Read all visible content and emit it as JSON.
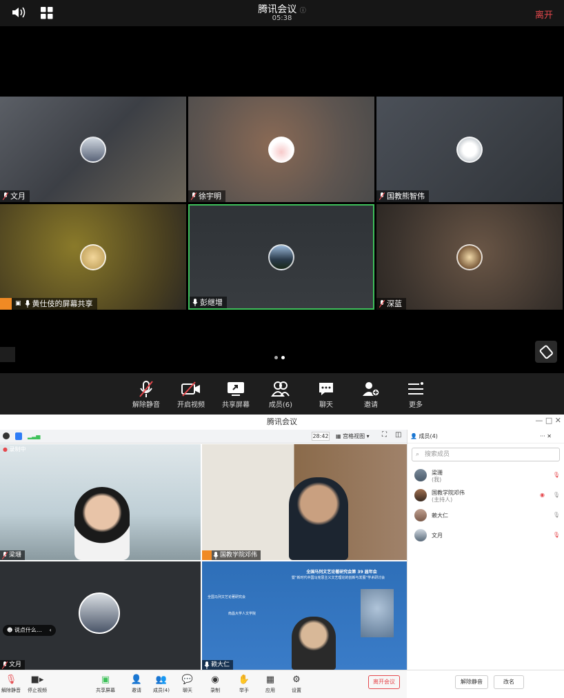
{
  "top": {
    "title": "腾讯会议",
    "timer": "05:38",
    "leave": "离开",
    "tiles": [
      {
        "name": "文月"
      },
      {
        "name": "徐宇明"
      },
      {
        "name": "国教熊智伟"
      },
      {
        "name": "黄仕伎的屏幕共享"
      },
      {
        "name": "彭继增"
      },
      {
        "name": "深蓝"
      }
    ],
    "toolbar": {
      "unmute": "解除静音",
      "start_video": "开启视频",
      "share_screen": "共享屏幕",
      "members": "成员(6)",
      "chat": "聊天",
      "invite": "邀请",
      "more": "更多"
    }
  },
  "bottom": {
    "title": "腾讯会议",
    "timer": "28:42",
    "grid_view": "宫格视图",
    "recording": "录制中",
    "tiles": [
      {
        "name": "梁珊"
      },
      {
        "name": "国教学院邓伟"
      },
      {
        "name": "文月"
      },
      {
        "name": "赖大仁"
      }
    ],
    "caption": "说点什么…",
    "slide_title": "全国马列文艺论著研究会第 39 届年会",
    "slide_subtitle": "暨“新时代中国马克思主义文艺理论的创新与发展”学术研讨会",
    "slide_host1": "全国马列文艺论著研究会",
    "slide_host2": "南昌大学人文学院",
    "panel": {
      "header": "成员(4)",
      "search_placeholder": "搜索成员",
      "members": [
        {
          "name": "梁珊",
          "role": "(我)"
        },
        {
          "name": "国教学院邓伟",
          "role": "(主持人)"
        },
        {
          "name": "赖大仁",
          "role": ""
        },
        {
          "name": "文月",
          "role": ""
        }
      ],
      "mute_all": "解除静音",
      "rename": "改名"
    },
    "toolbar": {
      "unmute": "解除静音",
      "stop_video": "停止视频",
      "share_screen": "共享屏幕",
      "invite": "邀请",
      "members": "成员(4)",
      "chat": "聊天",
      "record": "录制",
      "raise_hand": "举手",
      "apps": "应用",
      "settings": "设置",
      "end": "离开会议"
    }
  },
  "colors": {
    "accent_red": "#e5484d",
    "active_border": "#3ec15a"
  }
}
